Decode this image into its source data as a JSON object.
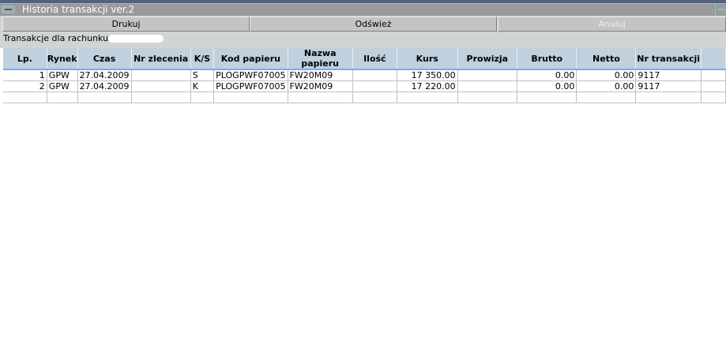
{
  "window": {
    "title": "Historia transakcji ver.2"
  },
  "toolbar": {
    "print": "Drukuj",
    "refresh": "Odśwież",
    "cancel": "Anuluj"
  },
  "account_label": "Transakcje dla rachunku",
  "columns": [
    "Lp.",
    "Rynek",
    "Czas",
    "Nr zlecenia",
    "K/S",
    "Kod papieru",
    "Nazwa papieru",
    "Ilość",
    "Kurs",
    "Prowizja",
    "Brutto",
    "Netto",
    "Nr transakcji",
    ""
  ],
  "rows": [
    [
      "1",
      "GPW",
      "27.04.2009",
      "",
      "S",
      "PLOGPWF07005",
      "FW20M09",
      "",
      "17 350.00",
      "",
      "0.00",
      "0.00",
      "9117",
      ""
    ],
    [
      "2",
      "GPW",
      "27.04.2009",
      "",
      "K",
      "PLOGPWF07005",
      "FW20M09",
      "",
      "17 220.00",
      "",
      "0.00",
      "0.00",
      "9117",
      ""
    ],
    [
      "",
      "",
      "",
      "",
      "",
      "",
      "",
      "",
      "",
      "",
      "",
      "",
      "",
      ""
    ]
  ],
  "colors": {
    "header": "#c0d0dc",
    "selection": "#7fa8f0",
    "titlebar": "#9a9a9a"
  }
}
